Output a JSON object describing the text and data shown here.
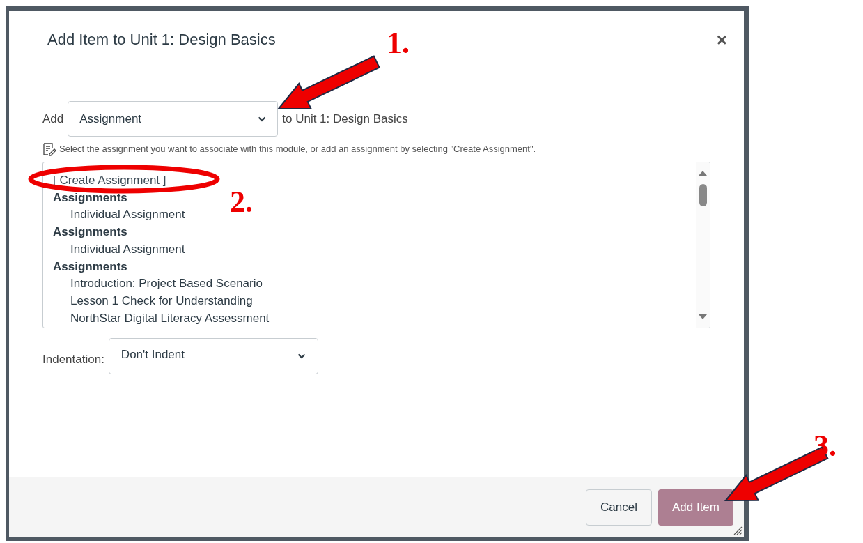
{
  "dialog": {
    "title": "Add Item to Unit 1: Design Basics",
    "close": "×"
  },
  "add_row": {
    "label": "Add",
    "select_value": "Assignment",
    "suffix": "to Unit 1: Design Basics"
  },
  "hint": "Select the assignment you want to associate with this module, or add an assignment by selecting \"Create Assignment\".",
  "list": [
    {
      "kind": "action",
      "text": "[ Create Assignment ]"
    },
    {
      "kind": "group",
      "text": "Assignments"
    },
    {
      "kind": "item",
      "text": "Individual Assignment"
    },
    {
      "kind": "group",
      "text": "Assignments"
    },
    {
      "kind": "item",
      "text": "Individual Assignment"
    },
    {
      "kind": "group",
      "text": "Assignments"
    },
    {
      "kind": "item",
      "text": "Introduction: Project Based Scenario"
    },
    {
      "kind": "item",
      "text": "Lesson 1 Check for Understanding"
    },
    {
      "kind": "item",
      "text": "NorthStar Digital Literacy Assessment"
    }
  ],
  "indentation": {
    "label": "Indentation:",
    "select_value": "Don't Indent"
  },
  "buttons": [
    {
      "label": "Cancel",
      "kind": "secondary"
    },
    {
      "label": "Add Item",
      "kind": "primary"
    }
  ],
  "annotations": [
    {
      "kind": "arrow"
    },
    {
      "kind": "number",
      "text": "1."
    },
    {
      "kind": "ellipse"
    },
    {
      "kind": "number",
      "text": "2."
    },
    {
      "kind": "arrow"
    },
    {
      "kind": "number",
      "text": "3."
    }
  ]
}
